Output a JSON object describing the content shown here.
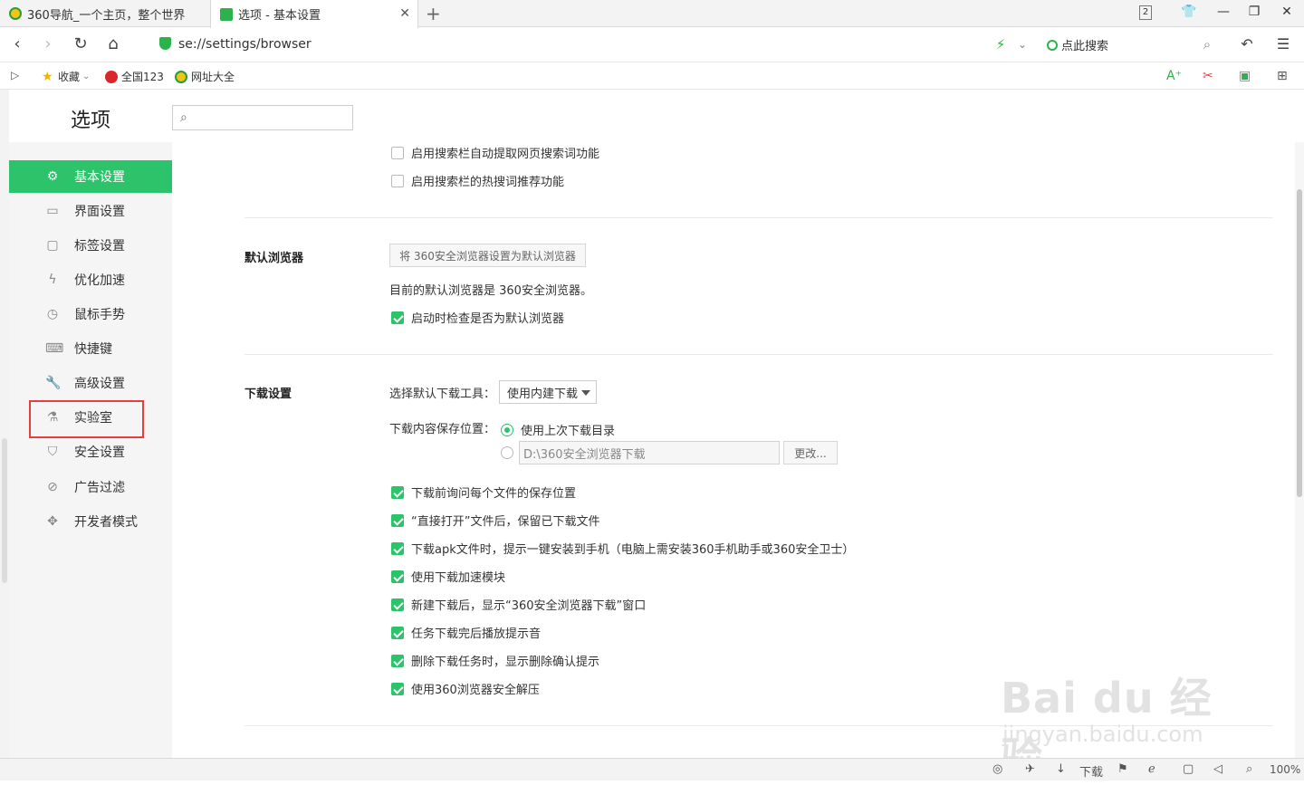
{
  "tabs": [
    {
      "title": "360导航_一个主页，整个世界"
    },
    {
      "title": "选项 - 基本设置"
    }
  ],
  "window": {
    "tab_count": "2"
  },
  "address": {
    "url": "se://settings/browser",
    "search_label": "点此搜索"
  },
  "bookmarks": [
    {
      "label": "收藏"
    },
    {
      "label": "全国123"
    },
    {
      "label": "网址大全"
    }
  ],
  "header": {
    "title": "选项"
  },
  "sidebar": {
    "items": [
      {
        "label": "基本设置",
        "icon": "gear-icon"
      },
      {
        "label": "界面设置",
        "icon": "window-icon"
      },
      {
        "label": "标签设置",
        "icon": "tag-icon"
      },
      {
        "label": "优化加速",
        "icon": "lightning-icon"
      },
      {
        "label": "鼠标手势",
        "icon": "mouse-icon"
      },
      {
        "label": "快捷键",
        "icon": "keyboard-icon"
      },
      {
        "label": "高级设置",
        "icon": "wrench-icon"
      },
      {
        "label": "实验室",
        "icon": "flask-icon"
      },
      {
        "label": "安全设置",
        "icon": "shield-icon"
      },
      {
        "label": "广告过滤",
        "icon": "block-icon"
      },
      {
        "label": "开发者模式",
        "icon": "puzzle-icon"
      }
    ]
  },
  "search_section": {
    "options": [
      {
        "label": "启用搜索栏自动提取网页搜索词功能",
        "checked": false
      },
      {
        "label": "启用搜索栏的热搜词推荐功能",
        "checked": false
      }
    ]
  },
  "default_browser": {
    "title": "默认浏览器",
    "set_button": "将 360安全浏览器设置为默认浏览器",
    "status": "目前的默认浏览器是 360安全浏览器。",
    "check_label": "启动时检查是否为默认浏览器",
    "check_on": true
  },
  "download": {
    "title": "下载设置",
    "tool_label": "选择默认下载工具：",
    "tool_value": "使用内建下载",
    "location_label": "下载内容保存位置：",
    "radio_last": "使用上次下载目录",
    "path_value": "D:\\360安全浏览器下载",
    "change_button": "更改...",
    "options": [
      {
        "label": "下载前询问每个文件的保存位置",
        "checked": true
      },
      {
        "label": "“直接打开”文件后，保留已下载文件",
        "checked": true
      },
      {
        "label": "下载apk文件时，提示一键安装到手机（电脑上需安装360手机助手或360安全卫士）",
        "checked": true
      },
      {
        "label": "使用下载加速模块",
        "checked": true
      },
      {
        "label": "新建下载后，显示“360安全浏览器下载”窗口",
        "checked": true
      },
      {
        "label": "任务下载完后播放提示音",
        "checked": true
      },
      {
        "label": "删除下载任务时，显示删除确认提示",
        "checked": true
      },
      {
        "label": "使用360浏览器安全解压",
        "checked": true
      }
    ]
  },
  "statusbar": {
    "download_label": "下载",
    "zoom": "100%"
  },
  "watermark": {
    "main": "Bai du 经验",
    "sub": "jingyan.baidu.com"
  },
  "colors": {
    "accent": "#2cc36b",
    "highlight_box": "#e53e3e"
  }
}
